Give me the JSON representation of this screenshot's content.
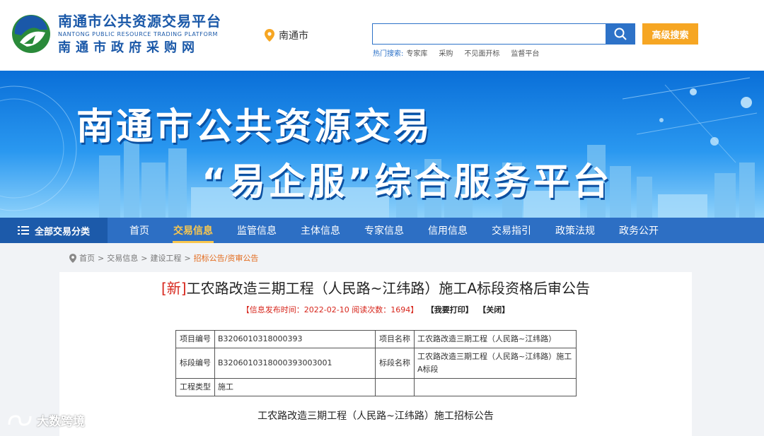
{
  "header": {
    "brand_cn": "南通市公共资源交易平台",
    "brand_en": "NANTONG PUBLIC RESOURCE TRADING PLATFORM",
    "brand_sub": "南通市政府采购网",
    "city": "南通市",
    "search_value": "",
    "advanced_search": "高级搜索",
    "hot_label": "热门搜索:",
    "hot_items": [
      "专家库",
      "采购",
      "不见面开标",
      "监督平台"
    ]
  },
  "banner": {
    "line1": "南通市公共资源交易",
    "line2": "“易企服”综合服务平台"
  },
  "nav": {
    "all_categories": "全部交易分类",
    "items": [
      "首页",
      "交易信息",
      "监管信息",
      "主体信息",
      "专家信息",
      "信用信息",
      "交易指引",
      "政策法规",
      "政务公开"
    ],
    "active_index": 1
  },
  "breadcrumb": [
    "首页",
    "交易信息",
    "建设工程",
    "招标公告/资审公告"
  ],
  "notice": {
    "tag": "[新]",
    "title": "工农路改造三期工程（人民路~江纬路）施工A标段资格后审公告",
    "meta": "【信息发布时间：2022-02-10 阅读次数：1694】",
    "print": "【我要打印】",
    "close": "【关闭】",
    "table": {
      "row1": {
        "l1": "项目编号",
        "v1": "B3206010318000393",
        "l2": "项目名称",
        "v2": "工农路改造三期工程（人民路~江纬路）"
      },
      "row2": {
        "l1": "标段编号",
        "v1": "B3206010318000393003001",
        "l2": "标段名称",
        "v2": "工农路改造三期工程（人民路~江纬路）施工A标段"
      },
      "row3": {
        "l1": "工程类型",
        "v1": "施工",
        "l2": "",
        "v2": ""
      }
    },
    "subtitle": "工农路改造三期工程（人民路~江纬路）施工招标公告"
  },
  "watermark": "大数跨境",
  "colors": {
    "primary": "#2d6fc4",
    "accent": "#f6a623",
    "highlight": "#f9c74f",
    "red": "#d7261c"
  }
}
